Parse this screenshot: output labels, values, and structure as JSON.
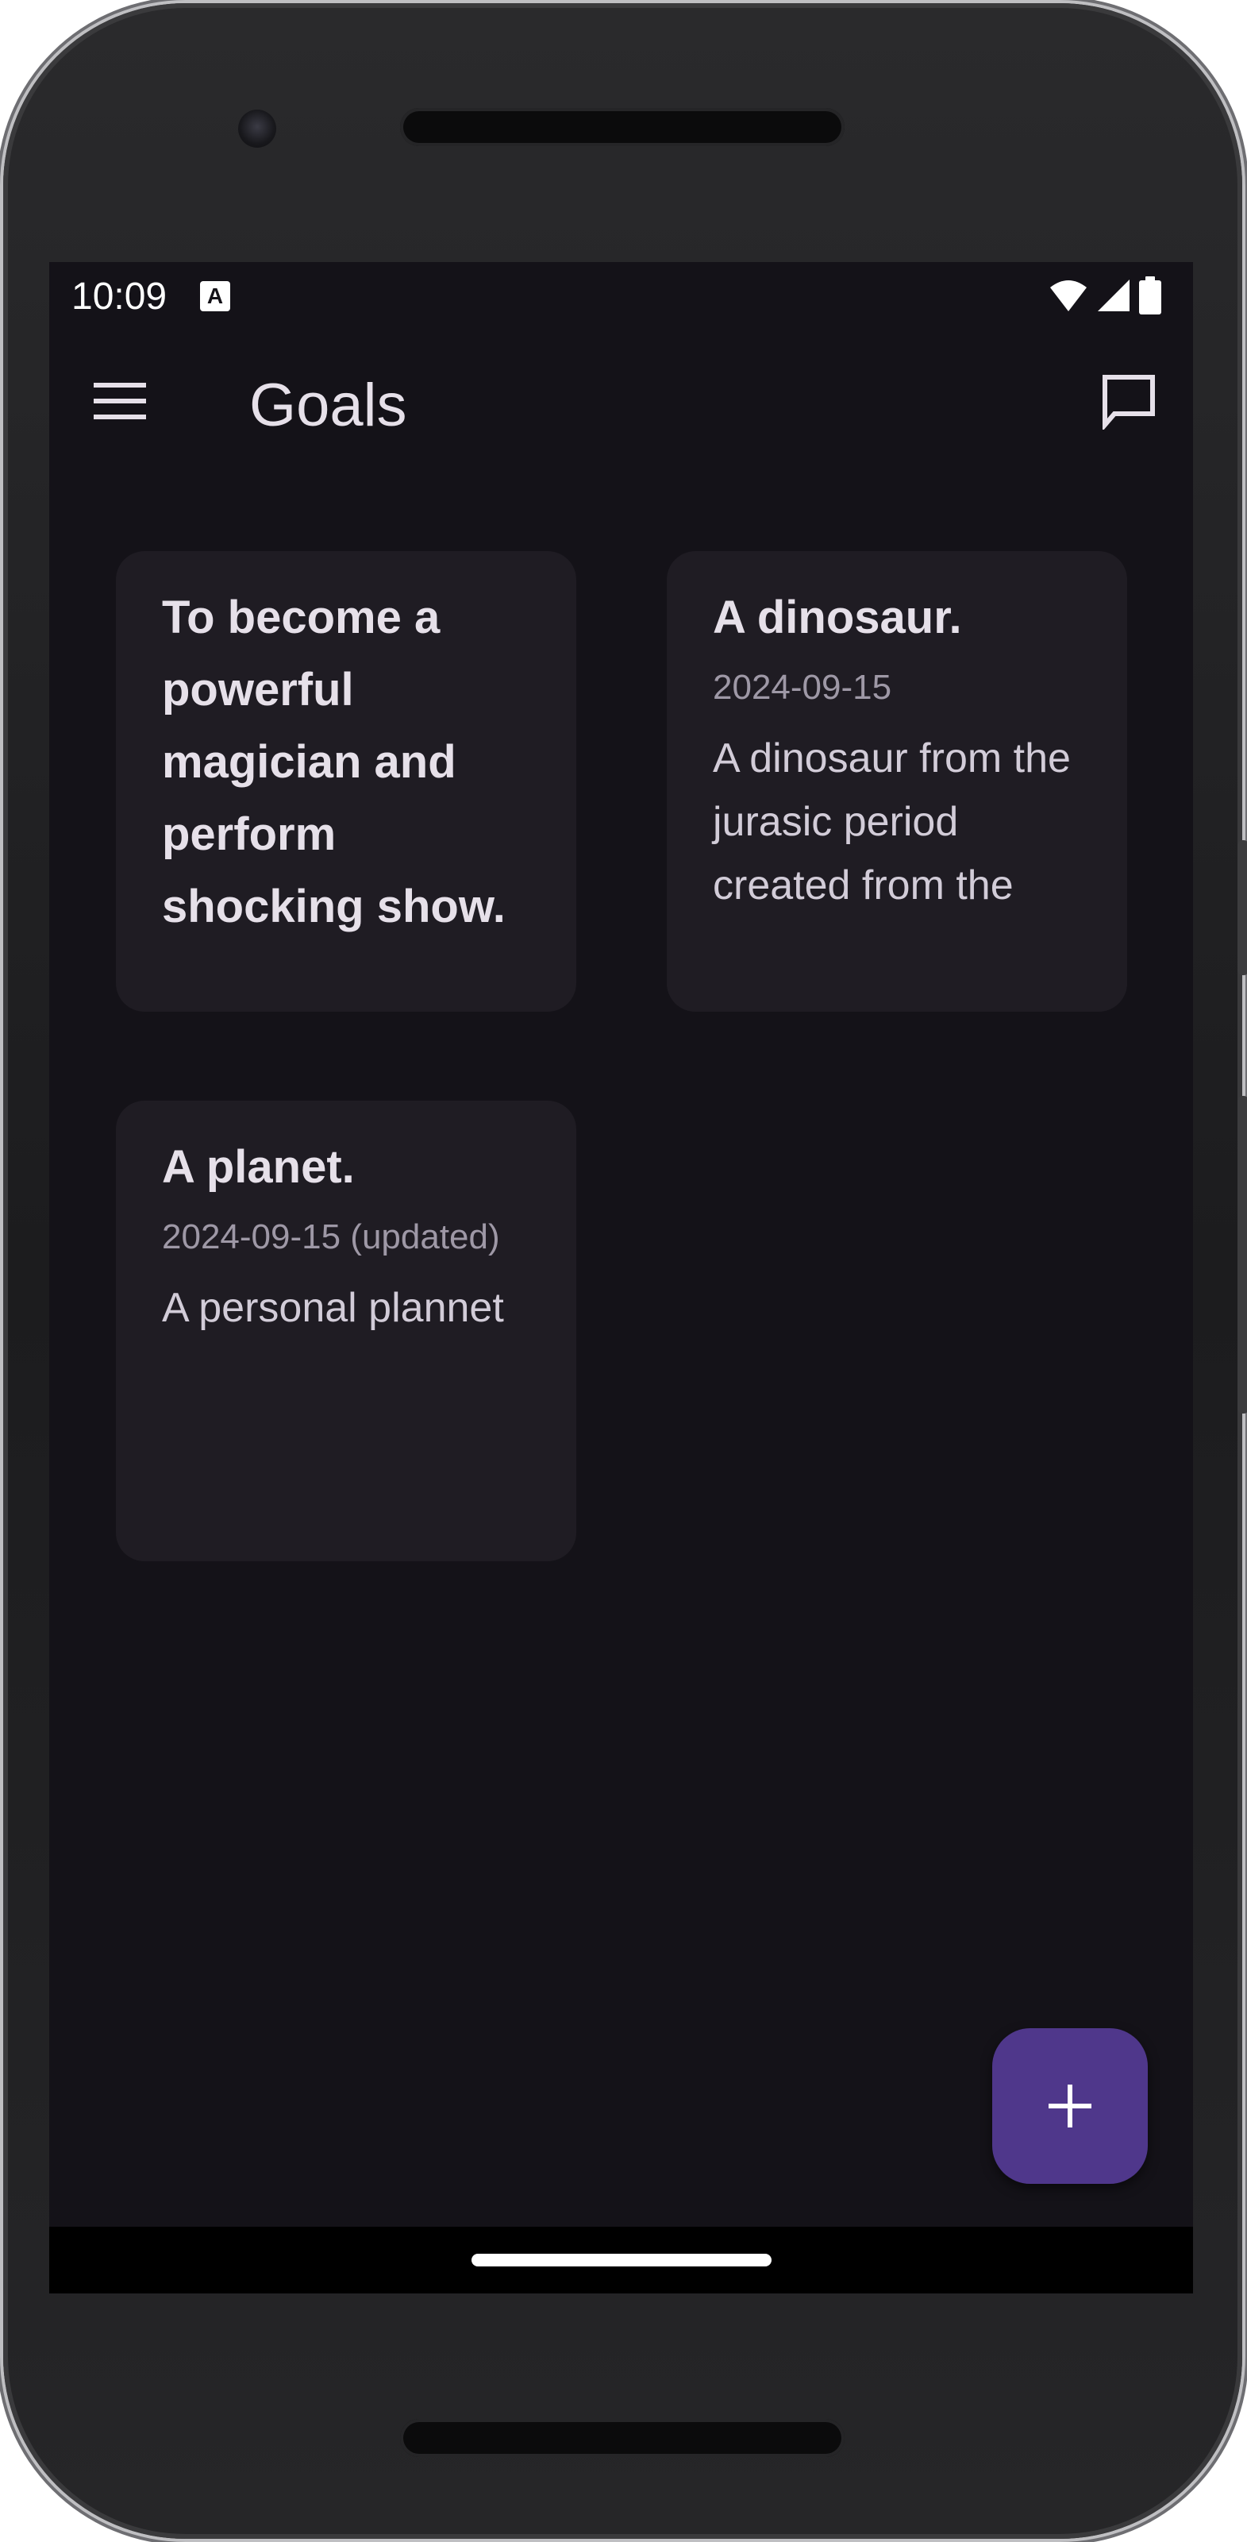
{
  "status_bar": {
    "time": "10:09",
    "notification_icon": "accessibility-a-icon",
    "icons": [
      "wifi-icon",
      "cell-signal-icon",
      "battery-icon"
    ]
  },
  "app_bar": {
    "title": "Goals",
    "menu_icon": "hamburger-menu-icon",
    "action_icon": "chat-bubble-icon"
  },
  "goals": [
    {
      "title": "To become a powerful magician and perform shocking show.",
      "date": "",
      "description": ""
    },
    {
      "title": "A dinosaur.",
      "date": "2024-09-15",
      "description": "A dinosaur from the jurasic period created from the"
    },
    {
      "title": "A planet.",
      "date": "2024-09-15 (updated)",
      "description": "A personal plannet"
    }
  ],
  "fab": {
    "icon": "plus-icon"
  },
  "colors": {
    "background": "#141218",
    "card": "#1f1c23",
    "fab": "#4f378b",
    "text_primary": "#e6e0e9",
    "text_secondary": "#9e98a6"
  }
}
